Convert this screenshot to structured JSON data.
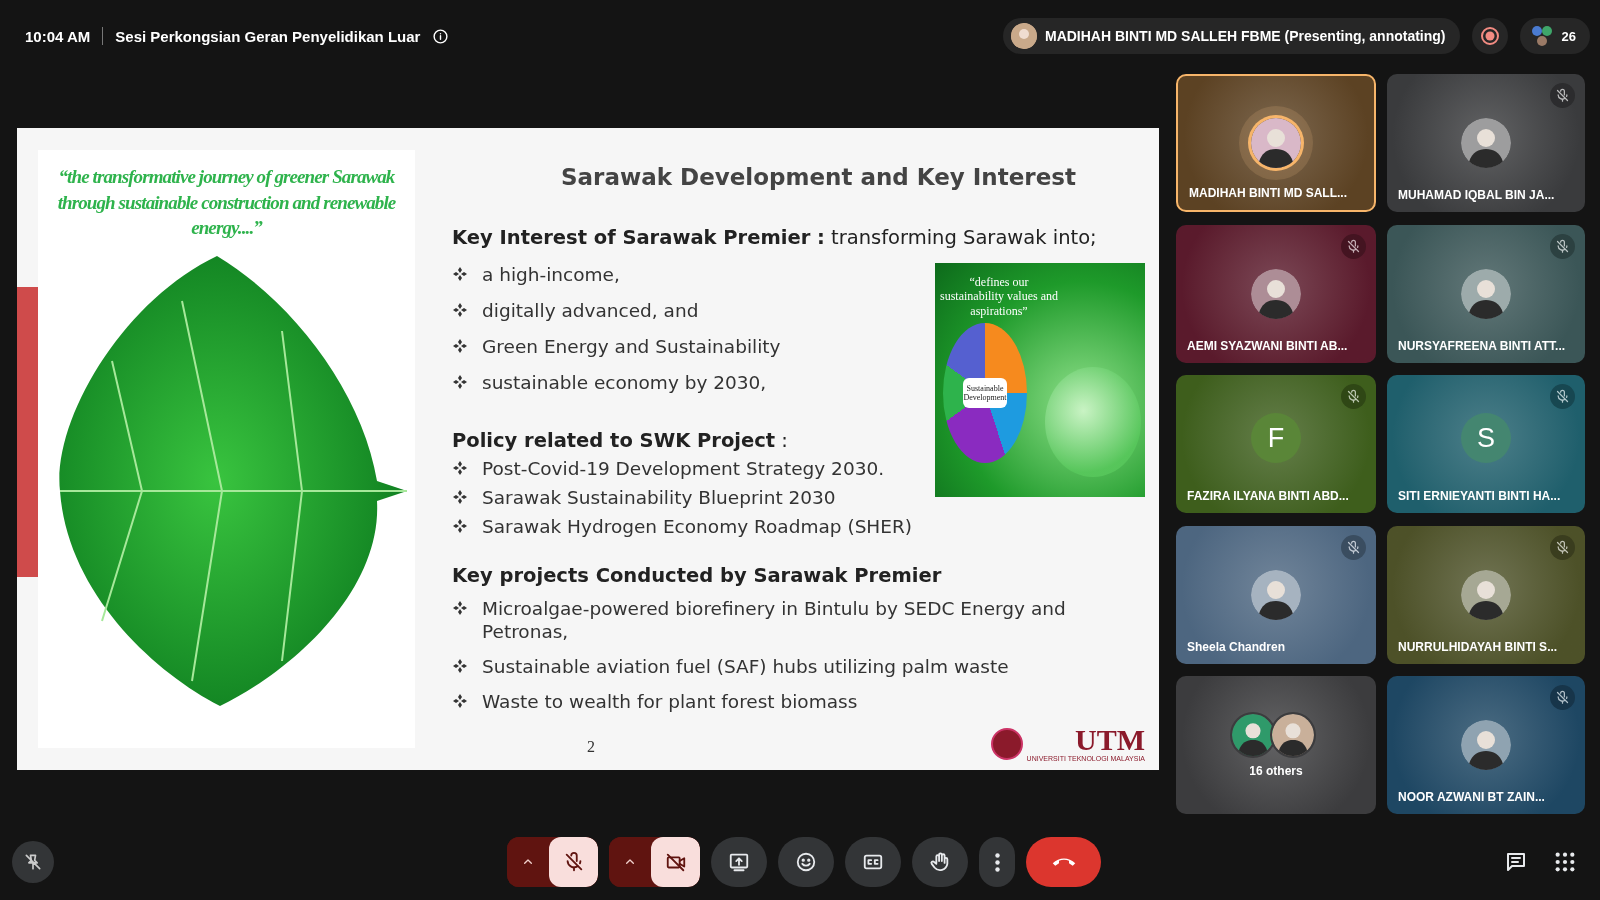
{
  "header": {
    "time": "10:04 AM",
    "meeting_title": "Sesi Perkongsian Geran Penyelidikan Luar",
    "presenter": "MADIHAH BINTI MD SALLEH FBME (Presenting, annotating)",
    "recording": true,
    "participant_count": "26"
  },
  "slide": {
    "quote": "“the transformative journey of greener Sarawak through sustainable construction and renewable energy....”",
    "title": "Sarawak Development and Key Interest",
    "sections": [
      {
        "heading": "Key Interest of Sarawak Premier :",
        "suffix": "transforming Sarawak into;",
        "items": [
          "a high-income,",
          "digitally advanced, and",
          "Green Energy and Sustainability",
          "sustainable economy by 2030,"
        ]
      },
      {
        "heading": "Policy  related to SWK Project",
        "suffix": ":",
        "items": [
          "Post-Covid-19 Development Strategy 2030.",
          "Sarawak Sustainability Blueprint 2030",
          "Sarawak Hydrogen Economy Roadmap (SHER)"
        ]
      },
      {
        "heading": "Key projects Conducted by Sarawak Premier",
        "items": [
          "Microalgae-powered biorefinery in Bintulu by SEDC Energy and Petronas,",
          "Sustainable aviation fuel (SAF) hubs utilizing palm waste",
          "Waste to wealth for plant forest biomass"
        ]
      }
    ],
    "image_caption": "“defines our sustainability values and aspirations”",
    "image_label": "Sustainable Development",
    "page_number": "2",
    "logo": {
      "name": "UTM",
      "subtitle": "UNIVERSITI TEKNOLOGI MALAYSIA"
    }
  },
  "tiles": [
    {
      "name": "MADIHAH BINTI MD SALL...",
      "kind": "photo",
      "color": "#5c4223",
      "muted": false,
      "selected": true
    },
    {
      "name": "MUHAMAD IQBAL BIN JA...",
      "kind": "photo",
      "color": "#3a3b3d",
      "muted": true,
      "selected": false
    },
    {
      "name": "AEMI SYAZWANI BINTI AB...",
      "kind": "photo",
      "color": "#5a1a2c",
      "muted": true,
      "selected": false
    },
    {
      "name": "NURSYAFREENA BINTI ATT...",
      "kind": "photo",
      "color": "#3b5657",
      "muted": true,
      "selected": false
    },
    {
      "name": "FAZIRA ILYANA BINTI ABD...",
      "kind": "initial",
      "initial": "F",
      "color": "#3e5e1c",
      "muted": true,
      "selected": false
    },
    {
      "name": "SITI ERNIEYANTI BINTI HA...",
      "kind": "initial",
      "initial": "S",
      "color": "#1f5f6c",
      "muted": true,
      "selected": false
    },
    {
      "name": "Sheela Chandren",
      "kind": "photo",
      "color": "#4d6680",
      "muted": true,
      "selected": false
    },
    {
      "name": "NURRULHIDAYAH BINTI S...",
      "kind": "photo",
      "color": "#4d5128",
      "muted": true,
      "selected": false
    },
    {
      "name": "16 others",
      "kind": "others",
      "color": "#3c3c3e",
      "muted": false,
      "selected": false
    },
    {
      "name": "NOOR AZWANI BT ZAIN...",
      "kind": "photo",
      "color": "#1e4763",
      "muted": true,
      "selected": false
    }
  ],
  "controls": [
    {
      "kind": "mic",
      "on": false
    },
    {
      "kind": "camera",
      "on": false
    },
    {
      "kind": "present"
    },
    {
      "kind": "emoji"
    },
    {
      "kind": "captions"
    },
    {
      "kind": "hand"
    },
    {
      "kind": "more"
    },
    {
      "kind": "leave"
    }
  ]
}
